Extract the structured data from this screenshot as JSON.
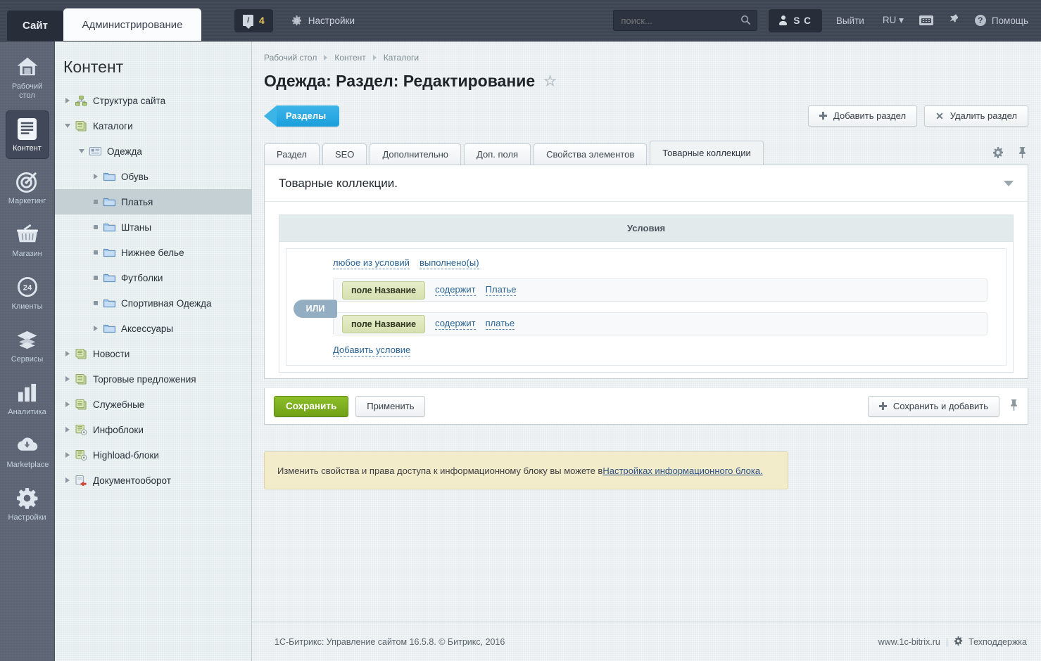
{
  "topbar": {
    "site_label": "Сайт",
    "admin_label": "Администрирование",
    "notification_count": "4",
    "notification_icon": "info-icon",
    "settings_label": "Настройки",
    "settings_icon": "gear-icon",
    "search_placeholder": "поиск...",
    "search_value": "",
    "search_icon": "search-icon",
    "user_initials": "S C",
    "user_icon": "person-icon",
    "logout_label": "Выйти",
    "language_label": "RU",
    "keyboard_icon": "keyboard-icon",
    "pin_icon": "pin-icon",
    "help_label": "Помощь",
    "help_icon": "question-icon"
  },
  "rail": {
    "items": [
      {
        "label": "Рабочий стол",
        "icon": "home-icon",
        "active": false
      },
      {
        "label": "Контент",
        "icon": "document-icon",
        "active": true
      },
      {
        "label": "Маркетинг",
        "icon": "target-icon",
        "active": false
      },
      {
        "label": "Магазин",
        "icon": "basket-icon",
        "active": false
      },
      {
        "label": "Клиенты",
        "icon": "clients-24-icon",
        "active": false
      },
      {
        "label": "Сервисы",
        "icon": "layers-icon",
        "active": false
      },
      {
        "label": "Аналитика",
        "icon": "bar-chart-icon",
        "active": false
      },
      {
        "label": "Marketplace",
        "icon": "cloud-download-icon",
        "active": false
      },
      {
        "label": "Настройки",
        "icon": "gear-icon",
        "active": false
      }
    ]
  },
  "tree": {
    "title": "Контент",
    "items": [
      {
        "label": "Структура сайта",
        "depth": 0,
        "marker": "collapsed",
        "icon": "sitemap-icon",
        "selected": false
      },
      {
        "label": "Каталоги",
        "depth": 0,
        "marker": "expanded",
        "icon": "iblock-icon",
        "selected": false
      },
      {
        "label": "Одежда",
        "depth": 1,
        "marker": "expanded",
        "icon": "list-icon",
        "selected": false
      },
      {
        "label": "Обувь",
        "depth": 2,
        "marker": "collapsed",
        "icon": "folder-icon",
        "selected": false
      },
      {
        "label": "Платья",
        "depth": 2,
        "marker": "leaf",
        "icon": "folder-icon",
        "selected": true
      },
      {
        "label": "Штаны",
        "depth": 2,
        "marker": "leaf",
        "icon": "folder-icon",
        "selected": false
      },
      {
        "label": "Нижнее белье",
        "depth": 2,
        "marker": "leaf",
        "icon": "folder-icon",
        "selected": false
      },
      {
        "label": "Футболки",
        "depth": 2,
        "marker": "leaf",
        "icon": "folder-icon",
        "selected": false
      },
      {
        "label": "Спортивная Одежда",
        "depth": 2,
        "marker": "leaf",
        "icon": "folder-icon",
        "selected": false
      },
      {
        "label": "Аксессуары",
        "depth": 2,
        "marker": "collapsed",
        "icon": "folder-icon",
        "selected": false
      },
      {
        "label": "Новости",
        "depth": 0,
        "marker": "collapsed",
        "icon": "iblock-icon",
        "selected": false
      },
      {
        "label": "Торговые предложения",
        "depth": 0,
        "marker": "collapsed",
        "icon": "iblock-icon",
        "selected": false
      },
      {
        "label": "Служебные",
        "depth": 0,
        "marker": "collapsed",
        "icon": "iblock-icon",
        "selected": false
      },
      {
        "label": "Инфоблоки",
        "depth": 0,
        "marker": "collapsed",
        "icon": "iblock-gear-icon",
        "selected": false
      },
      {
        "label": "Highload-блоки",
        "depth": 0,
        "marker": "collapsed",
        "icon": "iblock-gear-icon",
        "selected": false
      },
      {
        "label": "Документооборот",
        "depth": 0,
        "marker": "collapsed",
        "icon": "workflow-icon",
        "selected": false
      }
    ]
  },
  "breadcrumbs": [
    "Рабочий стол",
    "Контент",
    "Каталоги"
  ],
  "page": {
    "title": "Одежда: Раздел: Редактирование",
    "favorite_icon": "star-icon",
    "section_tab_label": "Разделы",
    "add_section_label": "Добавить раздел",
    "delete_section_label": "Удалить раздел",
    "settings_icon": "gear-icon",
    "pin_icon": "pin-icon"
  },
  "tabs": [
    {
      "label": "Раздел",
      "active": false
    },
    {
      "label": "SEO",
      "active": false
    },
    {
      "label": "Дополнительно",
      "active": false
    },
    {
      "label": "Доп. поля",
      "active": false
    },
    {
      "label": "Свойства элементов",
      "active": false
    },
    {
      "label": "Товарные коллекции",
      "active": true
    }
  ],
  "panel": {
    "heading": "Товарные коллекции.",
    "collapse_icon": "caret-down-icon",
    "conditions_header": "Условия",
    "any_of_label": "любое из условий",
    "fulfilled_label": "выполнено(ы)",
    "group_operator": "ИЛИ",
    "add_condition_label": "Добавить условие",
    "conditions": [
      {
        "field": "поле Название",
        "operator": "содержит",
        "value": "Платье"
      },
      {
        "field": "поле Название",
        "operator": "содержит",
        "value": "платье"
      }
    ]
  },
  "actions": {
    "save_label": "Сохранить",
    "apply_label": "Применить",
    "save_and_add_label": "Сохранить и добавить",
    "save_and_add_icon": "plus-icon",
    "pin_icon": "pin-icon"
  },
  "notice": {
    "text": "Изменить свойства и права доступа к информационному блоку вы можете в ",
    "link": "Настройках информационного блока."
  },
  "footer": {
    "copyright": "1С-Битрикс: Управление сайтом 16.5.8. © Битрикс, 2016",
    "site_link": "www.1c-bitrix.ru",
    "separator": "|",
    "support_label": "Техподдержка",
    "support_icon": "gear-icon"
  },
  "colors": {
    "accent_blue": "#1b9fdc",
    "save_green": "#7aae1f",
    "topbar_dark": "#3f4756",
    "rail_gray": "#5d6575",
    "tree_bg": "#e4ecee",
    "notice_bg": "#f3eccb",
    "chip_green": "#d6e0b0",
    "or_badge": "#93aec3"
  }
}
